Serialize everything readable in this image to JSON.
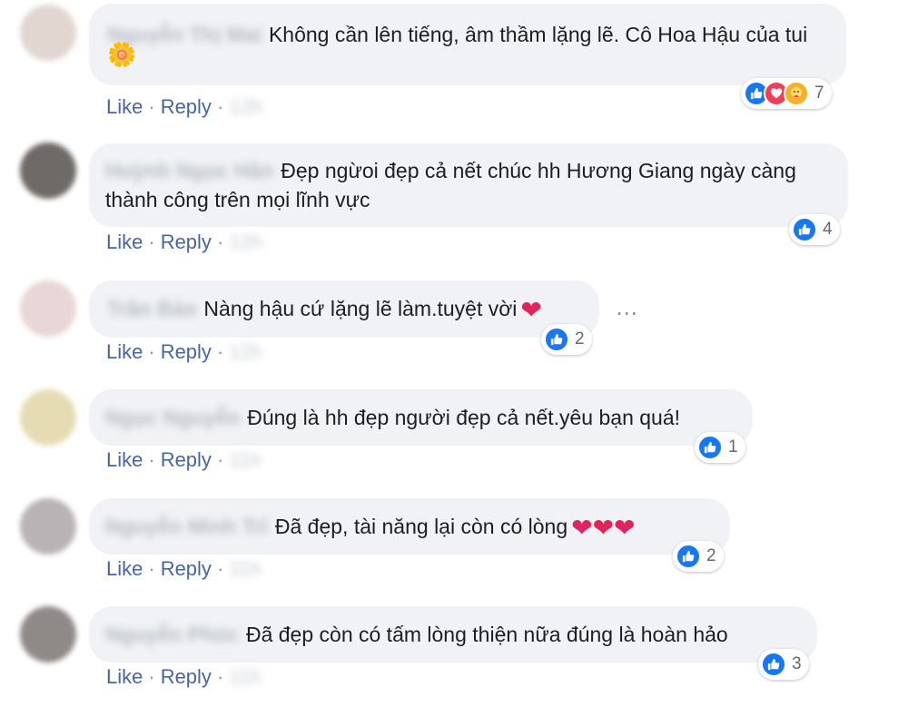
{
  "colors": {
    "like": "#1877f2",
    "love": "#f33e58",
    "care": "#f7b125",
    "bubble": "#f0f2f5",
    "link": "#385898"
  },
  "actions": {
    "like": "Like",
    "reply": "Reply",
    "sep": "·"
  },
  "more_icon": "⋯",
  "comments": [
    {
      "name": "Nguyễn Thị Mai",
      "text": "Không cần lên tiếng, âm thầm lặng lẽ. Cô Hoa Hậu của tui",
      "emoji": "🌼",
      "reactions": 7,
      "time": "12h"
    },
    {
      "name": "Huỳnh Ngọc Hân",
      "text": "Đẹp ngừoi đẹp cả nết chúc hh Hương Giang ngày càng thành công trên mọi lĩnh vực",
      "reactions": 4,
      "time": "12h"
    },
    {
      "name": "Trần Bảo",
      "text": "Nàng hậu cứ lặng lẽ làm.tuyệt vời",
      "hearts": "❤",
      "reactions": 2,
      "time": "12h"
    },
    {
      "name": "Ngọc Nguyễn",
      "text": "Đúng là hh đẹp người đẹp cả nết.yêu bạn quá!",
      "reactions": 1,
      "time": "11h"
    },
    {
      "name": "Nguyễn Minh Trí",
      "text": "Đã đẹp, tài năng lại còn có lòng",
      "hearts": "❤❤❤",
      "reactions": 2,
      "time": "11h"
    },
    {
      "name": "Nguyễn Phúc",
      "text": "Đã đẹp còn có tấm lòng thiện nữa đúng là hoàn hảo",
      "reactions": 3,
      "time": "11h"
    }
  ]
}
